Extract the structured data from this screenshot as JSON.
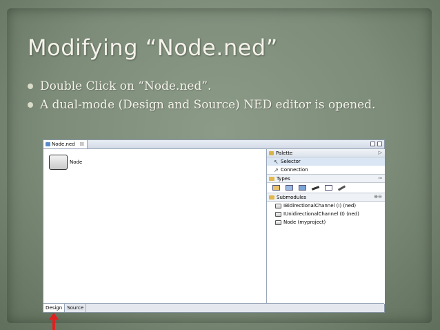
{
  "slide": {
    "title": "Modifying “Node.ned”",
    "bullets": [
      "Double Click on “Node.ned”.",
      "A dual-mode (Design and Source) NED editor is opened."
    ]
  },
  "editor": {
    "tab_label": "Node.ned",
    "tab_close": "☒",
    "node_label": "Node",
    "palette": {
      "title": "Palette",
      "selector": "Selector",
      "connection": "Connection",
      "types_header": "Types",
      "submodules_header": "Submodules",
      "submodules": [
        "IBidirectionalChannel (I) (ned)",
        "IUnidirectionalChannel (I) (ned)",
        "Node (myproject)"
      ]
    },
    "bottom_tabs": [
      "Design",
      "Source"
    ]
  },
  "colors": {
    "background": "#7d8c79",
    "title_text": "#f4f2ea",
    "arrow": "#e02020"
  }
}
